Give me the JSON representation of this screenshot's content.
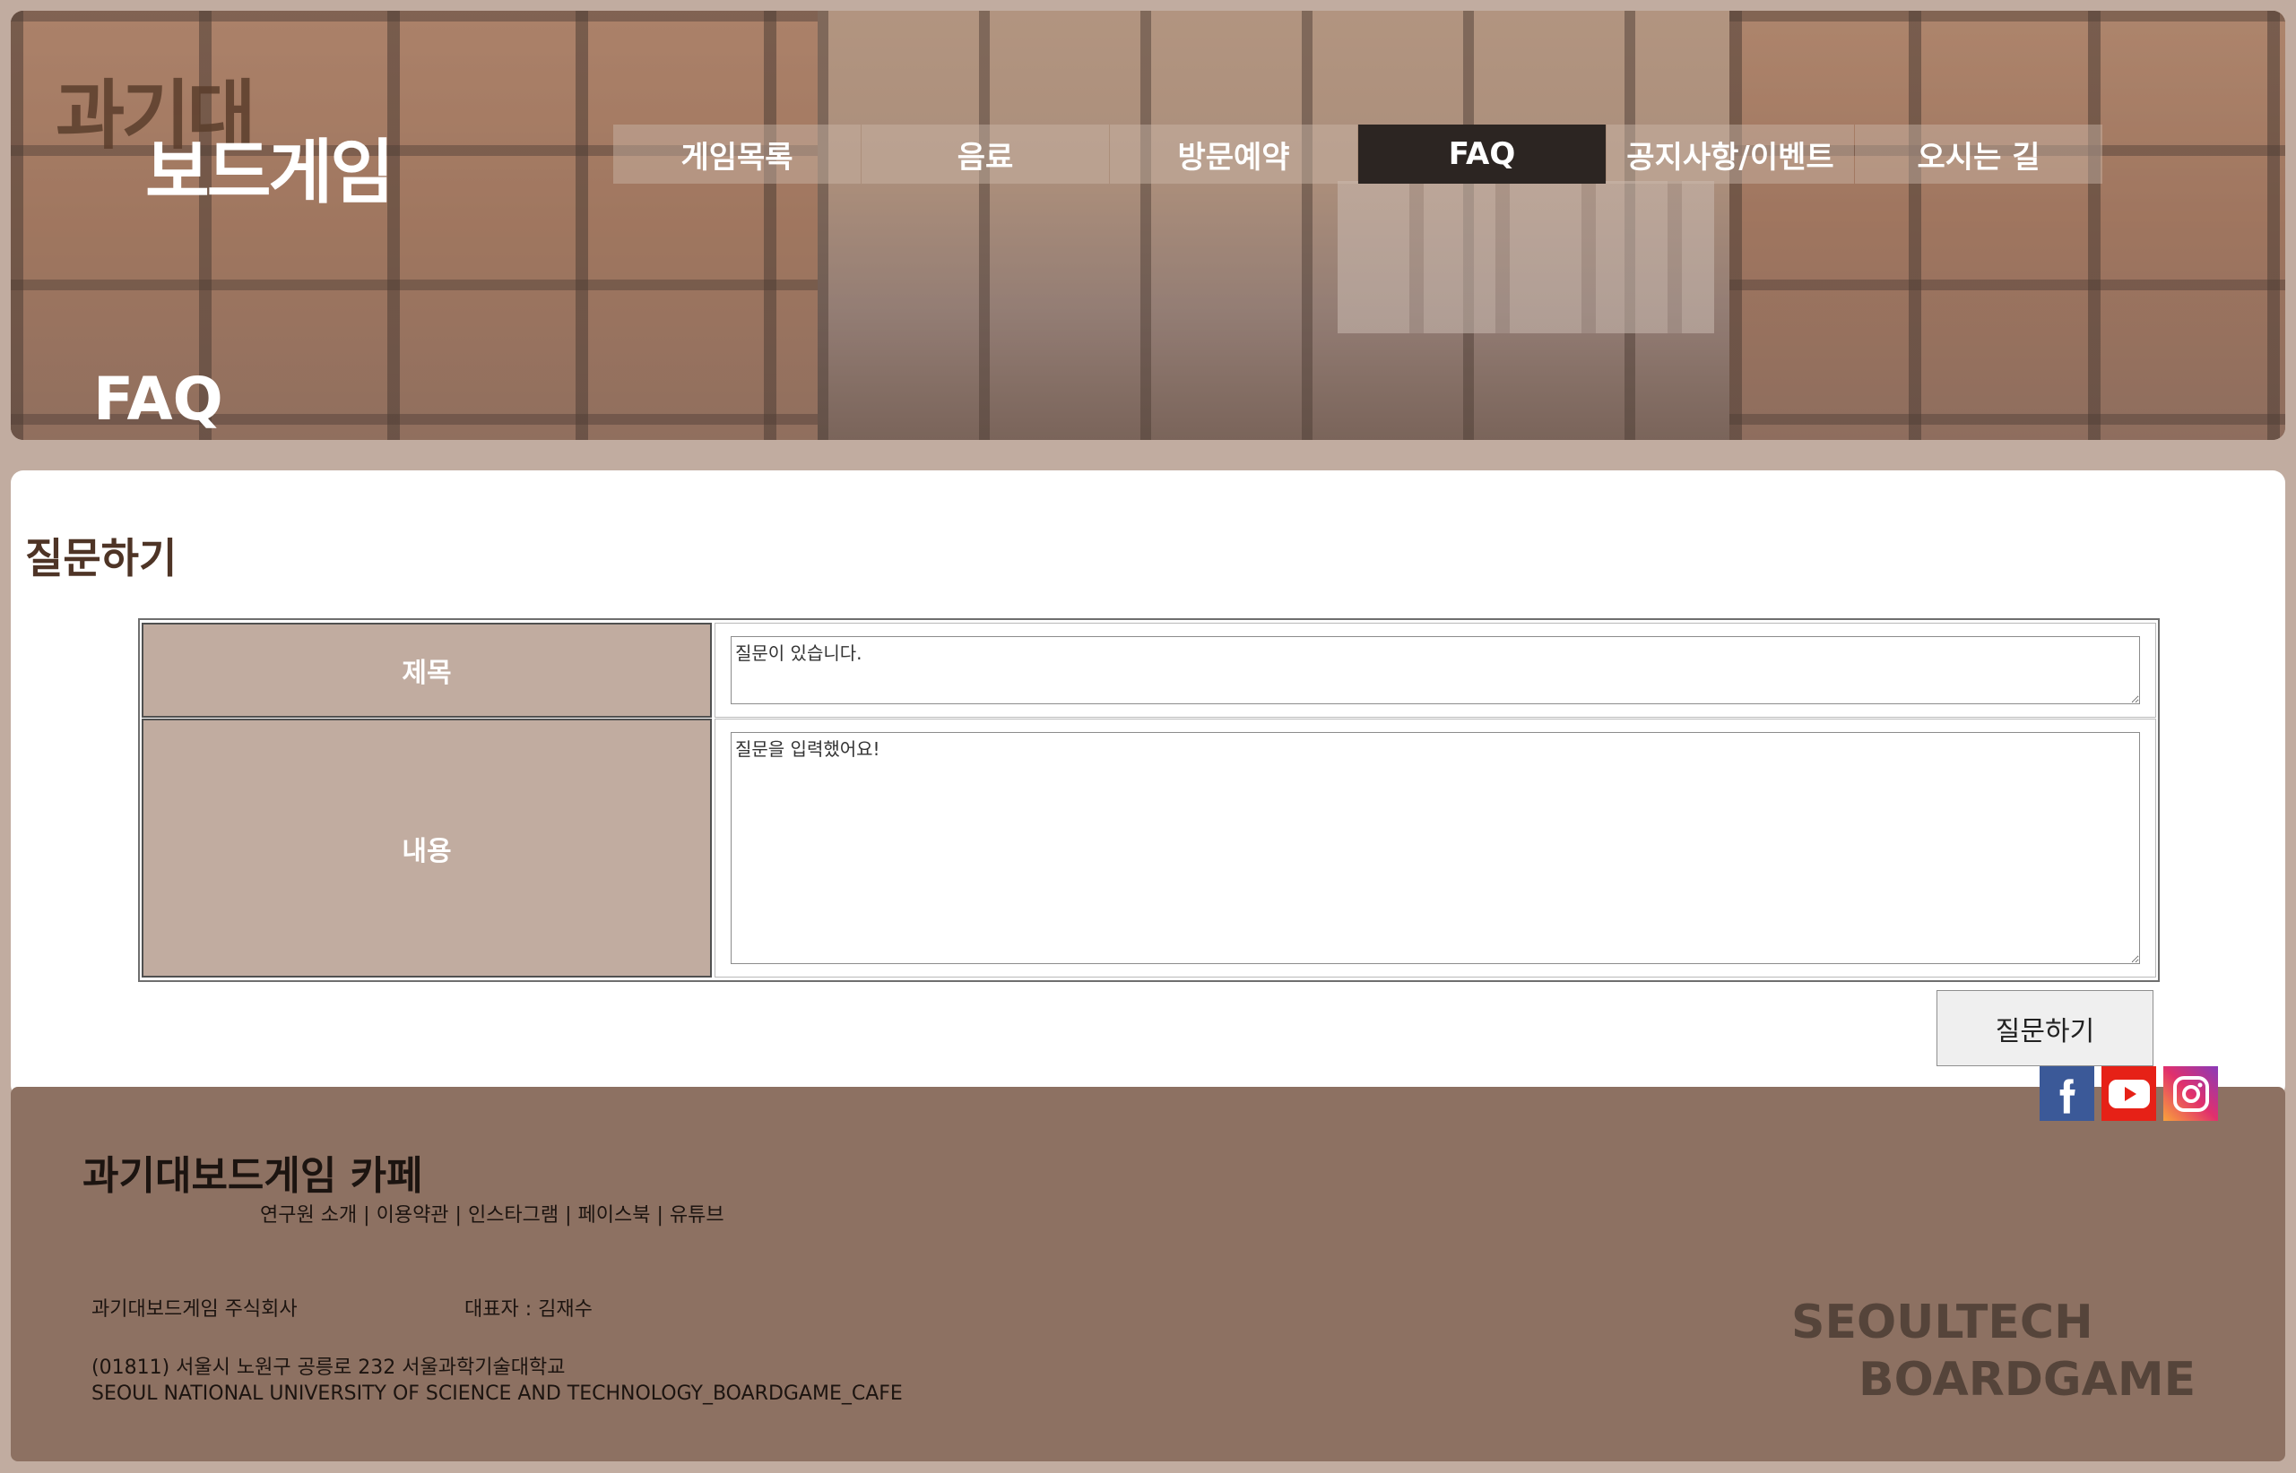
{
  "header": {
    "logo_line1": "과기대",
    "logo_line2": "보드게임",
    "hero_title": "FAQ",
    "nav": [
      {
        "label": "게임목록"
      },
      {
        "label": "음료"
      },
      {
        "label": "방문예약"
      },
      {
        "label": "FAQ",
        "active": true
      },
      {
        "label": "공지사항/이벤트"
      },
      {
        "label": "오시는 길"
      }
    ]
  },
  "main": {
    "section_title": "질문하기",
    "form": {
      "title_label": "제목",
      "title_value": "질문이 있습니다.",
      "content_label": "내용",
      "content_value": "질문을 입력했어요!",
      "submit_label": "질문하기"
    }
  },
  "social": [
    "facebook-icon",
    "youtube-icon",
    "instagram-icon"
  ],
  "footer": {
    "name": "과기대보드게임 카페",
    "links": "연구원 소개 | 이용약관 | 인스타그램 | 페이스북 | 유튜브",
    "company": "과기대보드게임 주식회사",
    "ceo": "대표자 : 김재수",
    "address": "(01811) 서울시 노원구 공릉로 232 서울과학기술대학교",
    "address_en": "SEOUL NATIONAL UNIVERSITY OF SCIENCE AND TECHNOLOGY_BOARDGAME_CAFE",
    "brand_line1": "SEOULTECH",
    "brand_line2": "BOARDGAME"
  },
  "colors": {
    "page_bg": "#c1aca0",
    "footer_bg": "#8d7162",
    "label_bg": "#c1aca0",
    "nav_active": "#2c2522",
    "title_text": "#4e3426"
  }
}
